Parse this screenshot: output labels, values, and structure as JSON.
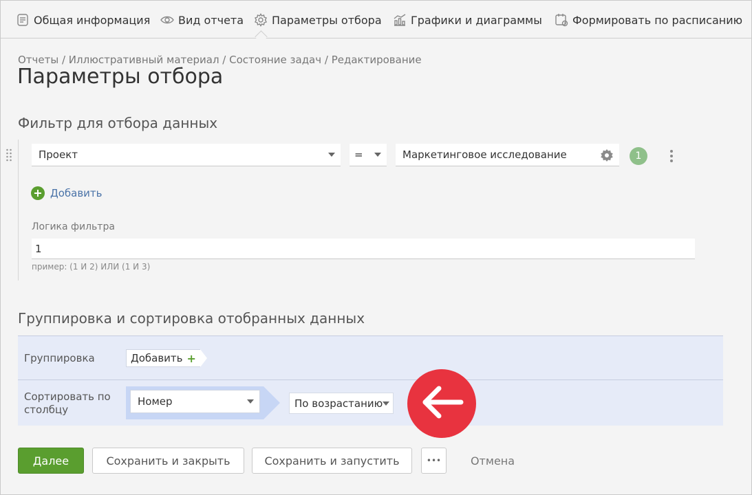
{
  "tabs": [
    {
      "label": "Общая информация",
      "icon": "document-icon"
    },
    {
      "label": "Вид отчета",
      "icon": "eye-icon"
    },
    {
      "label": "Параметры отбора",
      "icon": "gear-icon",
      "active": true
    },
    {
      "label": "Графики и диаграммы",
      "icon": "chart-icon"
    },
    {
      "label": "Формировать по расписанию",
      "icon": "calendar-icon"
    }
  ],
  "breadcrumb": "Отчеты / Иллюстративный материал / Состояние задач / Редактирование",
  "page_title": "Параметры отбора",
  "filter": {
    "section_title": "Фильтр для отбора данных",
    "field": "Проект",
    "operator": "=",
    "value": "Маркетинговое исследование",
    "index_badge": "1",
    "add_label": "Добавить",
    "logic_label": "Логика фильтра",
    "logic_value": "1",
    "logic_hint": "пример: (1 И 2) ИЛИ (1 И 3)"
  },
  "grouping": {
    "section_title": "Группировка и сортировка отобранных данных",
    "group_label": "Группировка",
    "group_add": "Добавить",
    "sort_label_line1": "Сортировать по",
    "sort_label_line2": "столбцу",
    "sort_column": "Номер",
    "sort_order": "По возрастанию"
  },
  "actions": {
    "next": "Далее",
    "save_close": "Сохранить и закрыть",
    "save_run": "Сохранить и запустить",
    "more": "•••",
    "cancel": "Отмена"
  },
  "colors": {
    "primary": "#5a9e2f",
    "badge": "#8fc08a",
    "panel": "#e6ebf8",
    "highlight_arrow": "#e8333f",
    "sort_band": "#c7d6f5"
  }
}
